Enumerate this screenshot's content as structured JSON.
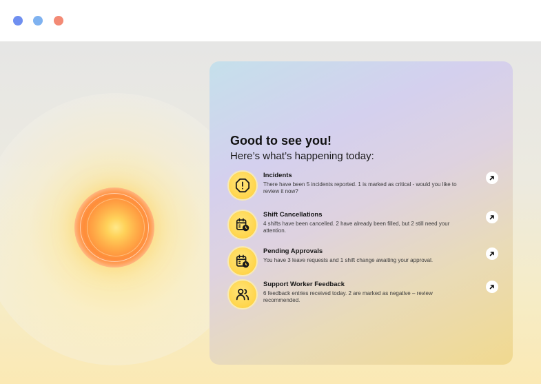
{
  "window": {
    "controls": [
      "close",
      "minimize",
      "maximize"
    ]
  },
  "greeting": {
    "title": "Good to see you!",
    "subtitle": "Here’s what’s happening today:"
  },
  "items": [
    {
      "title": "Incidents",
      "description": "There have been 5 incidents reported. 1 is marked as critical - would you like to review it now?",
      "icon": "alert-octagon-icon"
    },
    {
      "title": "Shift Cancellations",
      "description": "4 shifts have been cancelled. 2 have already been filled, but 2 still need your attention.",
      "icon": "calendar-clock-icon"
    },
    {
      "title": "Pending Approvals",
      "description": "You have 3 leave requests and 1 shift change awaiting your approval.",
      "icon": "calendar-clock-icon"
    },
    {
      "title": "Support Worker Feedback",
      "description": "6 feedback entries received today. 2 are marked as negative – review recommended.",
      "icon": "users-icon"
    }
  ],
  "colors": {
    "icon_bg": "#ffd54a",
    "dot_1": "#6f8ff0",
    "dot_2": "#7fb2f0",
    "dot_3": "#f38a75"
  }
}
